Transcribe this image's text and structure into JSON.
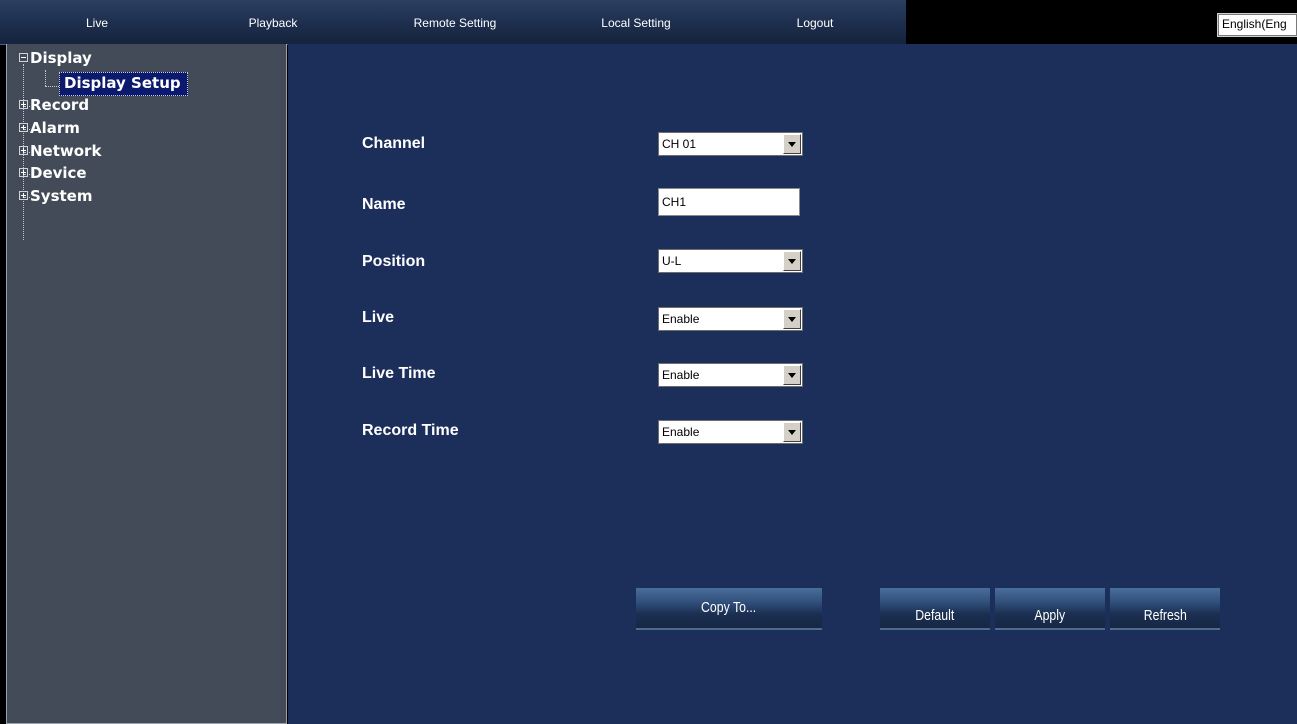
{
  "nav": {
    "items": [
      "Live",
      "Playback",
      "Remote Setting",
      "Local Setting",
      "Logout"
    ],
    "language": "English(Eng"
  },
  "sidebar": {
    "tree": [
      {
        "label": "Display",
        "expanded": true,
        "children": [
          "Display Setup"
        ]
      },
      {
        "label": "Record",
        "expanded": false
      },
      {
        "label": "Alarm",
        "expanded": false
      },
      {
        "label": "Network",
        "expanded": false
      },
      {
        "label": "Device",
        "expanded": false
      },
      {
        "label": "System",
        "expanded": false
      }
    ],
    "selected": "Display Setup"
  },
  "form": {
    "channel_label": "Channel",
    "channel_value": "CH 01",
    "name_label": "Name",
    "name_value": "CH1",
    "position_label": "Position",
    "position_value": "U-L",
    "live_label": "Live",
    "live_value": "Enable",
    "live_time_label": "Live Time",
    "live_time_value": "Enable",
    "record_time_label": "Record Time",
    "record_time_value": "Enable"
  },
  "buttons": {
    "copy_to": "Copy To...",
    "default": "Default",
    "apply": "Apply",
    "refresh": "Refresh"
  },
  "colors": {
    "main_bg": "#1c2f5a",
    "sidebar_bg": "#424b57",
    "selected_bg": "#0c1a6e"
  }
}
